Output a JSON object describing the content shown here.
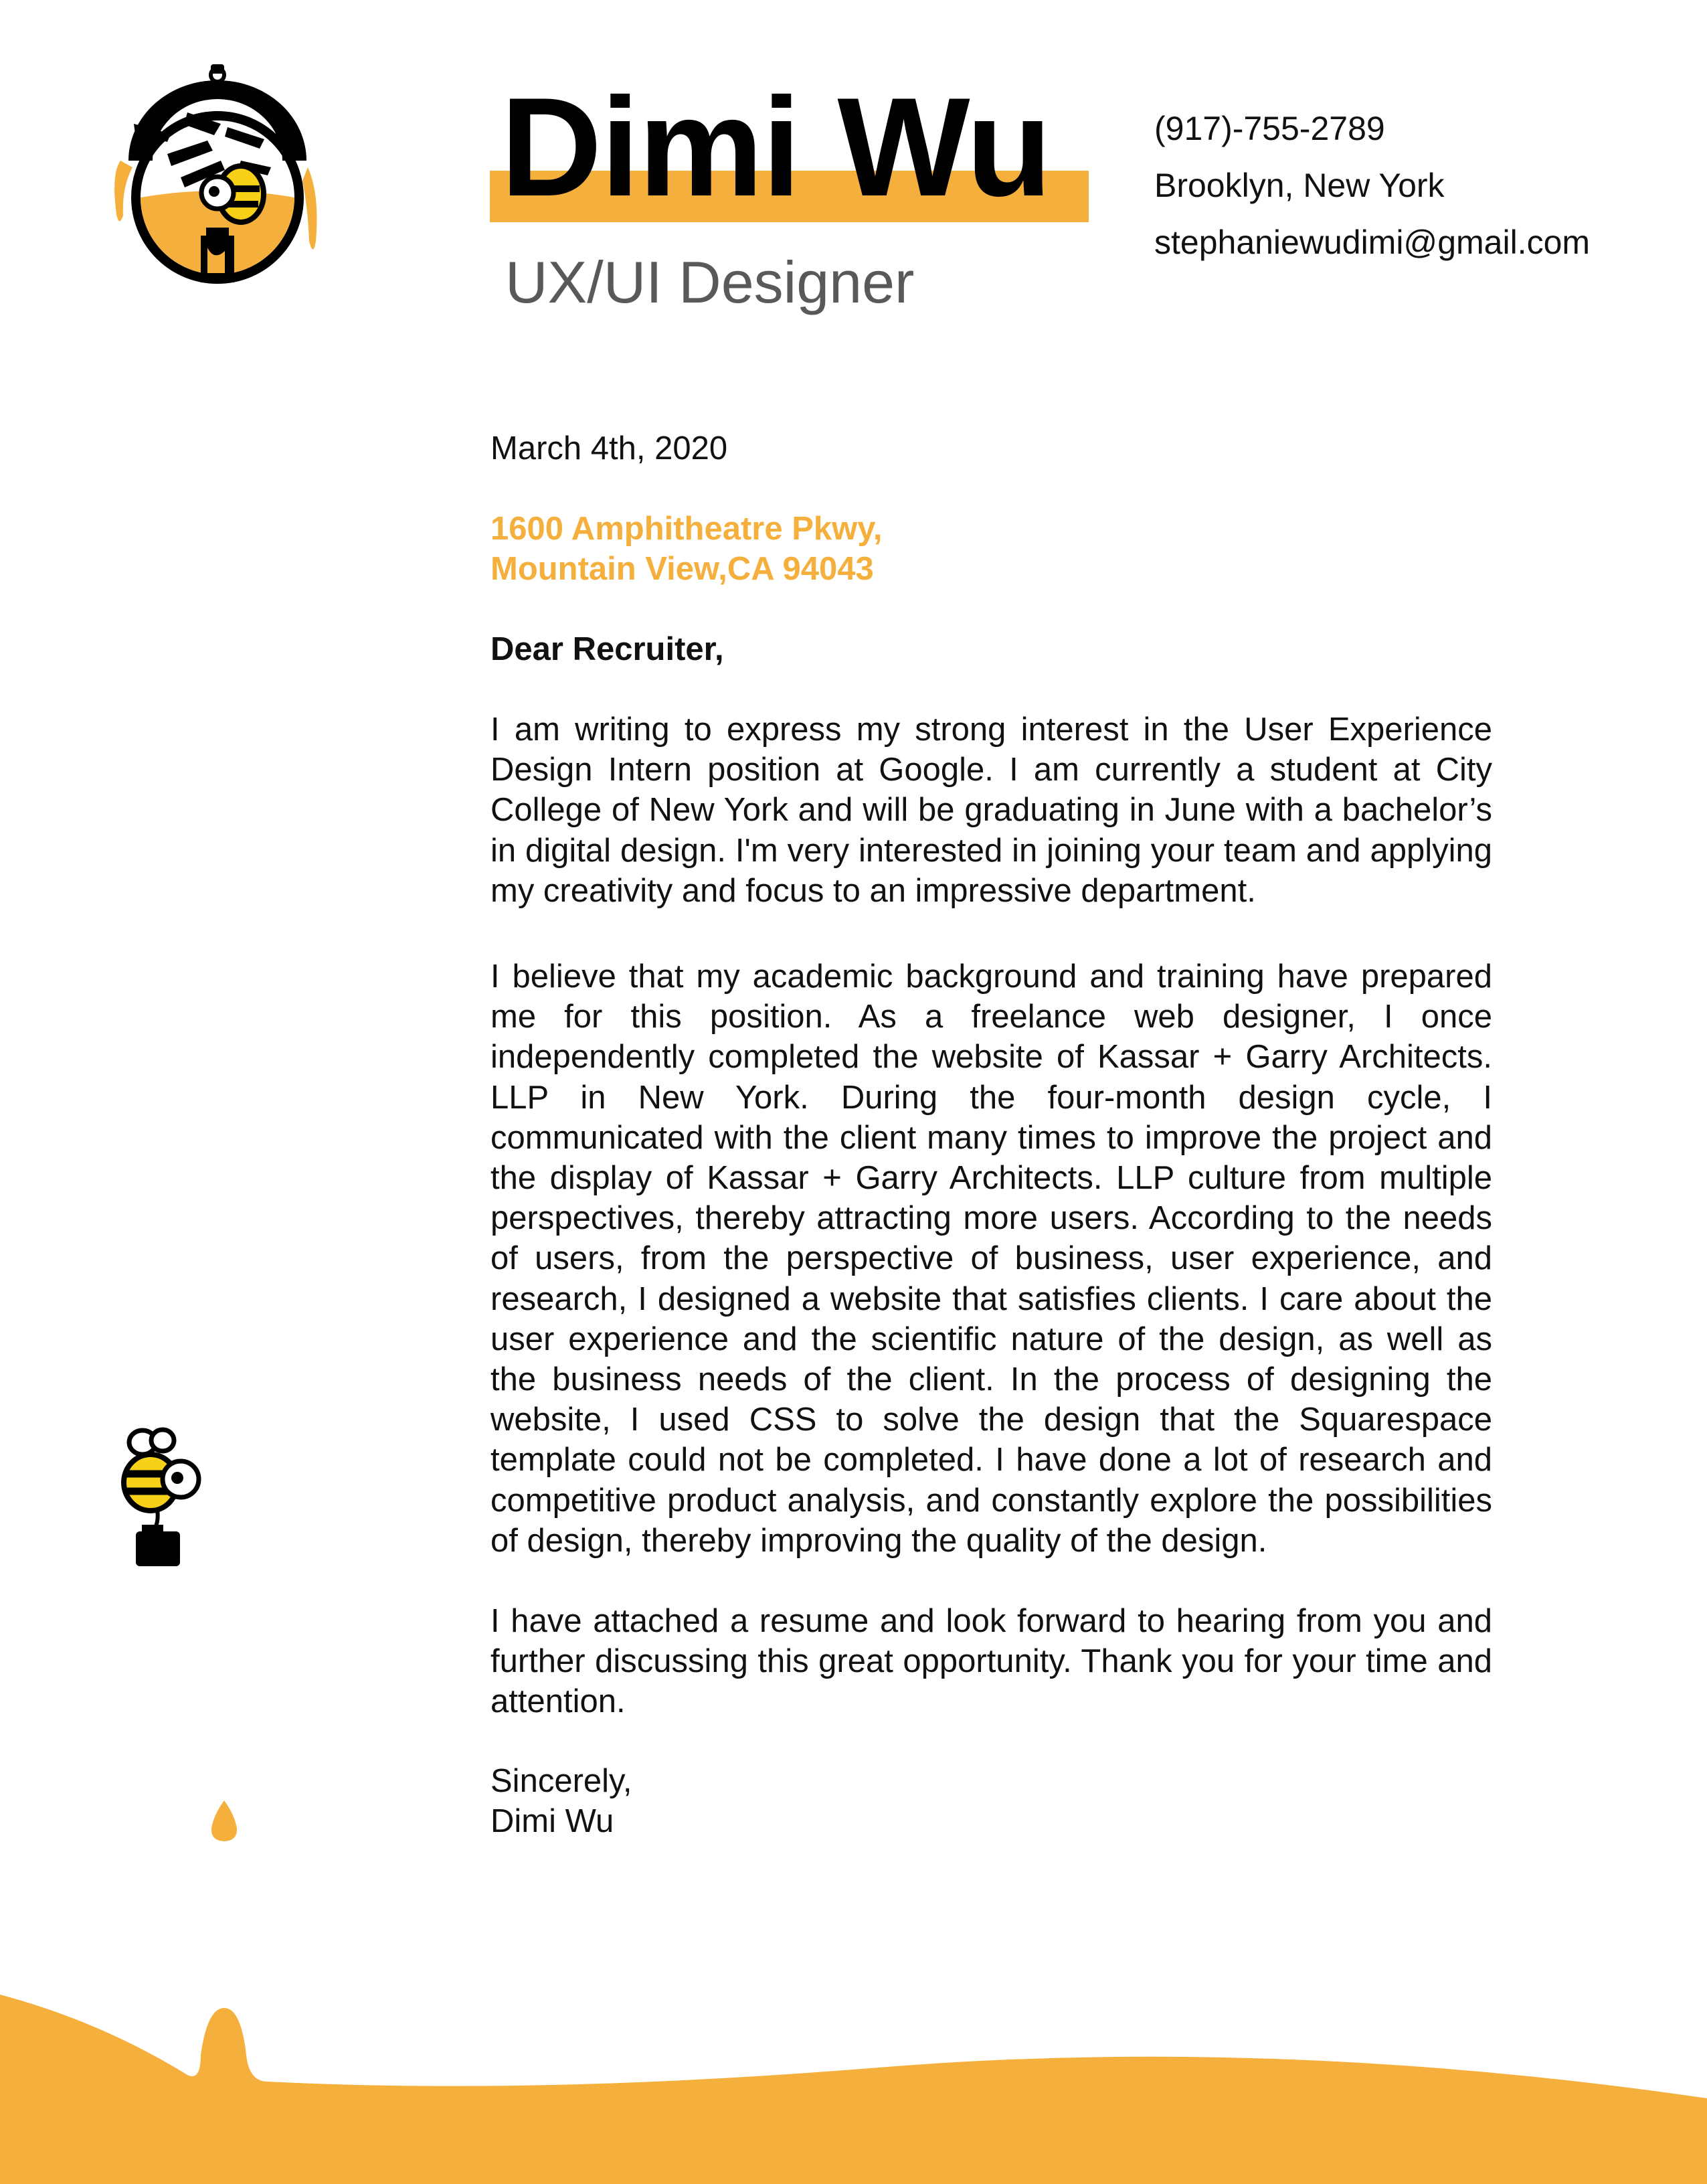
{
  "header": {
    "name": "Dimi Wu",
    "role": "UX/UI Designer",
    "contact": {
      "phone": "(917)-755-2789",
      "location": "Brooklyn, New York",
      "email": "stephaniewudimi@gmail.com"
    }
  },
  "letter": {
    "date": "March 4th, 2020",
    "address_line1": "1600 Amphitheatre Pkwy,",
    "address_line2": "Mountain View,CA 94043",
    "greeting": "Dear Recruiter,",
    "paragraphs": [
      "I am writing to express my strong interest in the User Experience Design Intern position at Google. I am currently a student at City College of New York and will be graduating in June with a bachelor’s in digital design. I'm very interested in joining your team and applying my creativity and focus to an impressive department.",
      "I believe that my academic background and training have prepared me for this position. As a freelance web designer, I once independently completed the website of Kassar + Garry Architects. LLP in New York. During the four-month design cycle, I communicated with the client many times to improve the project and the display of Kassar + Garry Architects. LLP culture from multiple perspectives, thereby attracting more users. According to the needs of users, from the perspective of business, user experience, and research, I designed a website that satisfies clients. I care about the user experience and the scientific nature of the design, as well as the business needs of the client. In the process of designing the website, I used CSS to solve the design that the Squarespace template could not be completed. I have done a lot of research and competitive product analysis, and constantly explore the possibilities of design, thereby improving the quality of the design.",
      "I have attached a resume and look forward to hearing from you and further discussing this great opportunity. Thank you for your time and attention."
    ],
    "closing": "Sincerely,",
    "signature": "Dimi Wu"
  },
  "colors": {
    "accent": "#F5AF3D",
    "text": "#111111",
    "subtitle": "#595959",
    "bee_yellow": "#F7D117"
  },
  "icons": [
    "logo-emblem-icon",
    "bee-mascot-icon",
    "honey-drop-icon",
    "honey-wave-decoration"
  ]
}
